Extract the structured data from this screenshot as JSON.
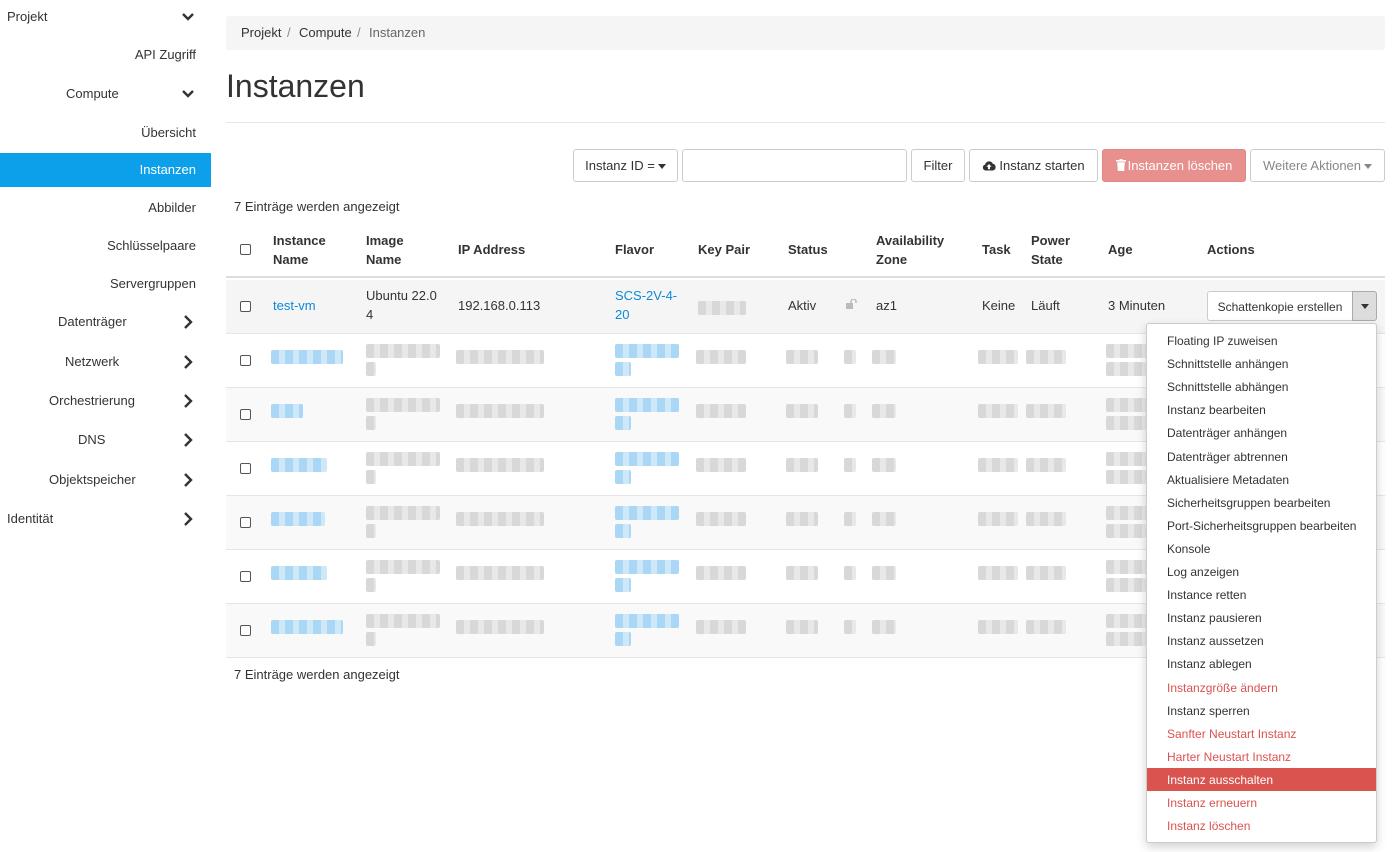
{
  "sidebar": {
    "items": [
      {
        "label": "Projekt",
        "chevron": "down"
      },
      {
        "label": "API Zugriff",
        "chevron": ""
      },
      {
        "label": "Compute",
        "chevron": "down"
      },
      {
        "label": "Übersicht",
        "chevron": ""
      },
      {
        "label": "Instanzen",
        "chevron": "",
        "active": true
      },
      {
        "label": "Abbilder",
        "chevron": ""
      },
      {
        "label": "Schlüsselpaare",
        "chevron": ""
      },
      {
        "label": "Servergruppen",
        "chevron": ""
      },
      {
        "label": "Datenträger",
        "chevron": "right"
      },
      {
        "label": "Netzwerk",
        "chevron": "right"
      },
      {
        "label": "Orchestrierung",
        "chevron": "right"
      },
      {
        "label": "DNS",
        "chevron": "right"
      },
      {
        "label": "Objektspeicher",
        "chevron": "right"
      },
      {
        "label": "Identität",
        "chevron": "right"
      }
    ],
    "active_color": "#0da0ea"
  },
  "breadcrumb": {
    "items": [
      "Projekt",
      "Compute",
      "Instanzen"
    ],
    "separator": "/"
  },
  "page": {
    "title": "Instanzen"
  },
  "toolbar": {
    "filter_field": "Instanz ID =",
    "filter_value": "",
    "filter_button": "Filter",
    "launch_button": "Instanz starten",
    "delete_button": "Instanzen löschen",
    "more_button": "Weitere Aktionen",
    "launch_icon": "cloud-upload-icon",
    "delete_icon": "trash-icon"
  },
  "summary": {
    "top": "7 Einträge werden angezeigt",
    "bottom": "7 Einträge werden angezeigt"
  },
  "table": {
    "headers": {
      "instance_name": [
        "Instance",
        "Name"
      ],
      "image_name": [
        "Image",
        "Name"
      ],
      "ip_address": "IP Address",
      "flavor": "Flavor",
      "key_pair": "Key Pair",
      "status": "Status",
      "availability_zone": [
        "Availability",
        "Zone"
      ],
      "task": "Task",
      "power_state": [
        "Power",
        "State"
      ],
      "age": "Age",
      "actions": "Actions"
    },
    "first_row": {
      "instance_name": "test-vm",
      "image_name": [
        "Ubuntu 22.0",
        "4"
      ],
      "ip_address": "192.168.0.113",
      "flavor": [
        "SCS-2V-4-",
        "20"
      ],
      "status": "Aktiv",
      "availability_zone": "az1",
      "task": "Keine",
      "power_state": "Läuft",
      "age": "3 Minuten",
      "action_button": "Schattenkopie erstellen"
    },
    "redacted_rows": 6
  },
  "actions_menu": {
    "items": [
      {
        "label": "Floating IP zuweisen",
        "style": "normal"
      },
      {
        "label": "Schnittstelle anhängen",
        "style": "normal"
      },
      {
        "label": "Schnittstelle abhängen",
        "style": "normal"
      },
      {
        "label": "Instanz bearbeiten",
        "style": "normal"
      },
      {
        "label": "Datenträger anhängen",
        "style": "normal"
      },
      {
        "label": "Datenträger abtrennen",
        "style": "normal"
      },
      {
        "label": "Aktualisiere Metadaten",
        "style": "normal"
      },
      {
        "label": "Sicherheitsgruppen bearbeiten",
        "style": "normal"
      },
      {
        "label": "Port-Sicherheitsgruppen bearbeiten",
        "style": "normal"
      },
      {
        "label": "Konsole",
        "style": "normal"
      },
      {
        "label": "Log anzeigen",
        "style": "normal"
      },
      {
        "label": "Instance retten",
        "style": "normal"
      },
      {
        "label": "Instanz pausieren",
        "style": "normal"
      },
      {
        "label": "Instanz aussetzen",
        "style": "normal"
      },
      {
        "label": "Instanz ablegen",
        "style": "normal"
      },
      {
        "label": "Instanzgröße ändern",
        "style": "danger"
      },
      {
        "label": "Instanz sperren",
        "style": "normal"
      },
      {
        "label": "Sanfter Neustart Instanz",
        "style": "danger"
      },
      {
        "label": "Harter Neustart Instanz",
        "style": "danger"
      },
      {
        "label": "Instanz ausschalten",
        "style": "highlighted"
      },
      {
        "label": "Instanz erneuern",
        "style": "danger"
      },
      {
        "label": "Instanz löschen",
        "style": "danger"
      }
    ],
    "danger_color": "#d9534f"
  }
}
